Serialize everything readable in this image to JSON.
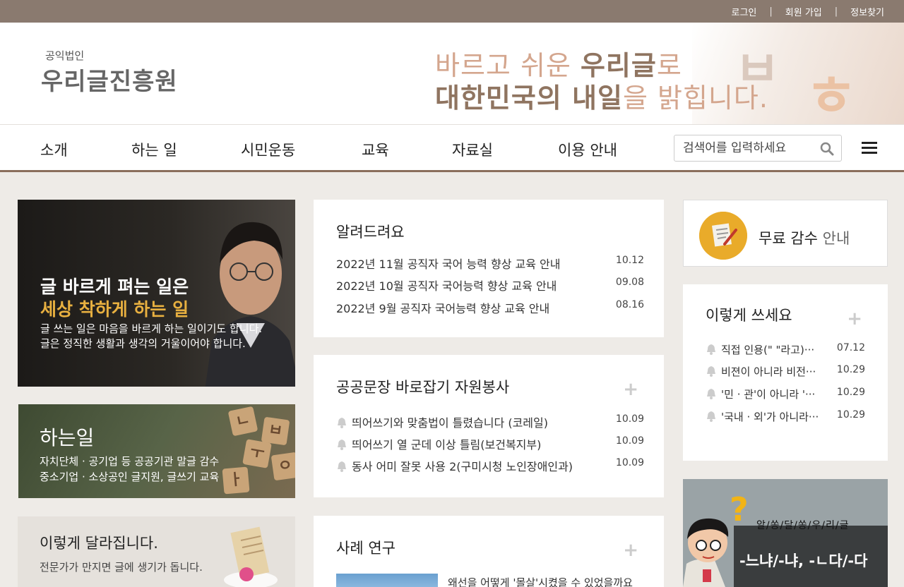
{
  "topbar": {
    "login": "로그인",
    "signup": "회원 가입",
    "find_info": "정보찾기",
    "separator": "|"
  },
  "header": {
    "logo_sub": "공익법인",
    "logo_main": "우리글진흥원",
    "slogan_line1_a": "바르고 쉬운 ",
    "slogan_line1_b": "우리글",
    "slogan_line1_c": "로",
    "slogan_line2_a": "대한민국의 내일",
    "slogan_line2_b": "을 밝힙니다."
  },
  "nav": {
    "items": [
      "소개",
      "하는 일",
      "시민운동",
      "교육",
      "자료실",
      "이용 안내"
    ],
    "search_placeholder": "검색어를 입력하세요"
  },
  "hero": {
    "headline1": "글 바르게 펴는 일은",
    "headline2": "세상 착하게 하는 일",
    "line1": "글 쓰는 일은 마음을 바르게 하는 일이기도 합니다.",
    "line2": "글은 정직한 생활과 생각의 거울이어야 합니다."
  },
  "work": {
    "title": "하는일",
    "line1": "자치단체 · 공기업 등 공공기관 말글 감수",
    "line2": "중소기업 · 소상공인 글지원, 글쓰기 교육"
  },
  "change": {
    "title": "이렇게 달라집니다.",
    "desc": "전문가가 만지면 글에 생기가 돕니다."
  },
  "notice": {
    "title": "알려드려요",
    "rows": [
      {
        "text": "2022년 11월 공직자 국어 능력 향상 교육 안내",
        "date": "10.12"
      },
      {
        "text": "2022년 10월 공직자 국어능력 향상 교육 안내",
        "date": "09.08"
      },
      {
        "text": "2022년 9월 공직자 국어능력 향상 교육 안내",
        "date": "08.16"
      }
    ]
  },
  "volunteer": {
    "title": "공공문장 바로잡기 자원봉사",
    "plus": "+",
    "rows": [
      {
        "text": "띄어쓰기와 맞춤법이 틀렸습니다 (코레일)",
        "date": "10.09"
      },
      {
        "text": "띄어쓰기 열 군데 이상 틀림(보건복지부)",
        "date": "10.09"
      },
      {
        "text": "동사 어미 잘못 사용 2(구미시청 노인장애인과)",
        "date": "10.09"
      }
    ]
  },
  "cases": {
    "title": "사례 연구",
    "plus": "+",
    "first_item": "왜선을 어떻게 '몰살'시켰을 수 있었을까요"
  },
  "free": {
    "label_a": "무료 감수",
    "label_b": " 안내"
  },
  "write": {
    "title": "이렇게 쓰세요",
    "plus": "+",
    "rows": [
      {
        "text": "직접 인용(\" \"라고)···",
        "date": "07.12"
      },
      {
        "text": "비젼이 아니라 비전···",
        "date": "10.29"
      },
      {
        "text": "'민 · 관'이 아니라 '···",
        "date": "10.29"
      },
      {
        "text": "'국내 · 외'가 아니라···",
        "date": "10.29"
      }
    ]
  },
  "comic": {
    "heading": "알/쏭/달/쏭/우/리/글",
    "chalk": "-느냐/-냐, -ㄴ다/-다",
    "question_mark": "?"
  },
  "colors": {
    "topbar": "#8a7a6f",
    "nav_underline": "#8a6e5c",
    "accent_brown": "#8f7460",
    "accent_peach": "#d4a68e",
    "badge": "#e9ab2a"
  }
}
